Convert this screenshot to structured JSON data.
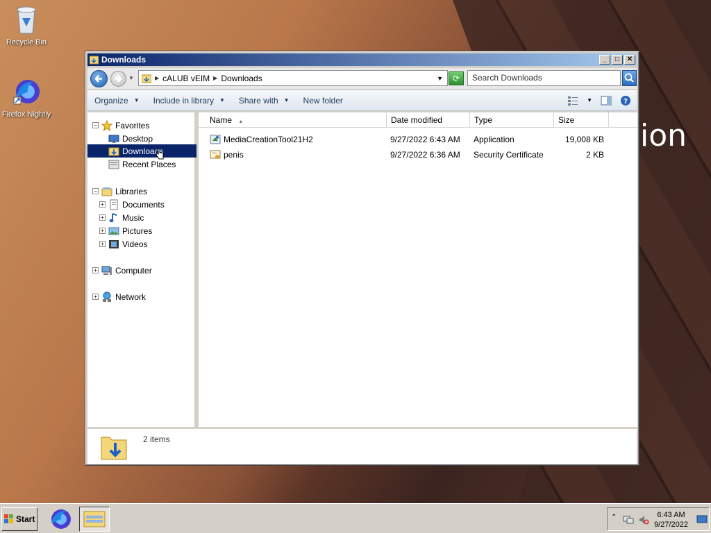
{
  "desktop": {
    "icons": [
      {
        "label": "Recycle Bin",
        "icon": "recycle-bin-icon"
      },
      {
        "label": "Firefox Nightly",
        "icon": "firefox-nightly-icon"
      }
    ],
    "wallpaper_text": "ion"
  },
  "window": {
    "title": "Downloads",
    "controls": {
      "minimize": "_",
      "maximize": "□",
      "close": "✕"
    },
    "address": {
      "crumbs": [
        "cALUB vEIM",
        "Downloads"
      ],
      "search_placeholder": "Search Downloads"
    },
    "toolbar": {
      "organize": "Organize",
      "include_in_library": "Include in library",
      "share_with": "Share with",
      "new_folder": "New folder"
    },
    "nav": {
      "favorites": "Favorites",
      "desktop": "Desktop",
      "downloads": "Downloads",
      "recent_places": "Recent Places",
      "libraries": "Libraries",
      "documents": "Documents",
      "music": "Music",
      "pictures": "Pictures",
      "videos": "Videos",
      "computer": "Computer",
      "network": "Network"
    },
    "columns": {
      "name": "Name",
      "date_modified": "Date modified",
      "type": "Type",
      "size": "Size"
    },
    "files": [
      {
        "name": "MediaCreationTool21H2",
        "date": "9/27/2022 6:43 AM",
        "type": "Application",
        "size": "19,008 KB"
      },
      {
        "name": "penis",
        "date": "9/27/2022 6:36 AM",
        "type": "Security Certificate",
        "size": "2 KB"
      }
    ],
    "details": {
      "count": "2 items"
    }
  },
  "taskbar": {
    "start": "Start",
    "clock_time": "6:43 AM",
    "clock_date": "9/27/2022"
  }
}
